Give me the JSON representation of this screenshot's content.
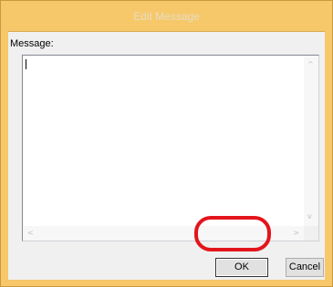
{
  "window": {
    "title": "Edit Message"
  },
  "form": {
    "message_label": "Message:",
    "message_value": ""
  },
  "scrollbars": {
    "up_icon": "chevron-up-icon",
    "down_icon": "chevron-down-icon",
    "left_icon": "chevron-left-icon",
    "right_icon": "chevron-right-icon"
  },
  "buttons": {
    "ok_label": "OK",
    "cancel_label": "Cancel"
  },
  "colors": {
    "titlebar": "#f6c86a",
    "highlight": "#e3141c"
  }
}
